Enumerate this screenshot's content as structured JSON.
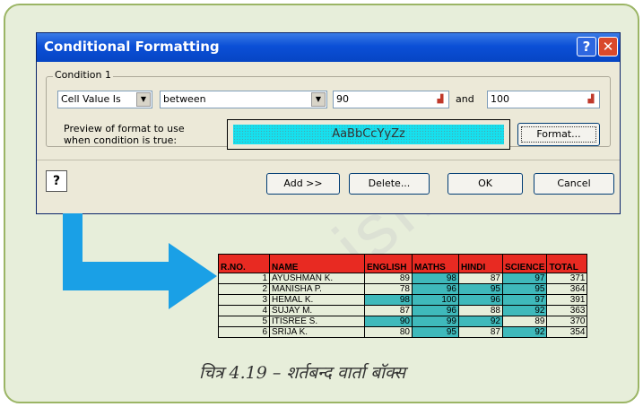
{
  "dialog": {
    "title": "Conditional Formatting",
    "help_glyph": "?",
    "close_glyph": "✕",
    "condition_label": "Condition 1",
    "cell_value_combo": "Cell Value Is",
    "operator_combo": "between",
    "value1": "90",
    "and_label": "and",
    "value2": "100",
    "preview_label_line1": "Preview of format to use",
    "preview_label_line2": "when condition is true:",
    "preview_sample": "AaBbCcYyZz",
    "format_button": "Format...",
    "add_button": "Add >>",
    "delete_button": "Delete...",
    "ok_button": "OK",
    "cancel_button": "Cancel"
  },
  "table": {
    "headers": [
      "R.NO.",
      "NAME",
      "ENGLISH",
      "MATHS",
      "HINDI",
      "SCIENCE",
      "TOTAL"
    ],
    "rows": [
      {
        "rno": "1",
        "name": "AYUSHMAN K.",
        "english": "89",
        "maths": "98",
        "hindi": "87",
        "science": "97",
        "total": "371"
      },
      {
        "rno": "2",
        "name": "MANISHA P.",
        "english": "78",
        "maths": "96",
        "hindi": "95",
        "science": "95",
        "total": "364"
      },
      {
        "rno": "3",
        "name": "HEMAL K.",
        "english": "98",
        "maths": "100",
        "hindi": "96",
        "science": "97",
        "total": "391"
      },
      {
        "rno": "4",
        "name": "SUJAY M.",
        "english": "87",
        "maths": "96",
        "hindi": "88",
        "science": "92",
        "total": "363"
      },
      {
        "rno": "5",
        "name": "ITISREE S.",
        "english": "90",
        "maths": "99",
        "hindi": "92",
        "science": "89",
        "total": "370"
      },
      {
        "rno": "6",
        "name": "SRIJA K.",
        "english": "80",
        "maths": "95",
        "hindi": "87",
        "science": "92",
        "total": "354"
      }
    ]
  },
  "caption": "चित्र 4.19 – शर्तबन्द वार्ता बॉक्स",
  "colors": {
    "frame_border": "#9bb565",
    "frame_fill": "#e7eeda",
    "header_red": "#e82a22",
    "highlight_teal": "#3fb9bb",
    "arrow_blue": "#1aa0e6",
    "preview_cyan": "#16e0ee"
  }
}
